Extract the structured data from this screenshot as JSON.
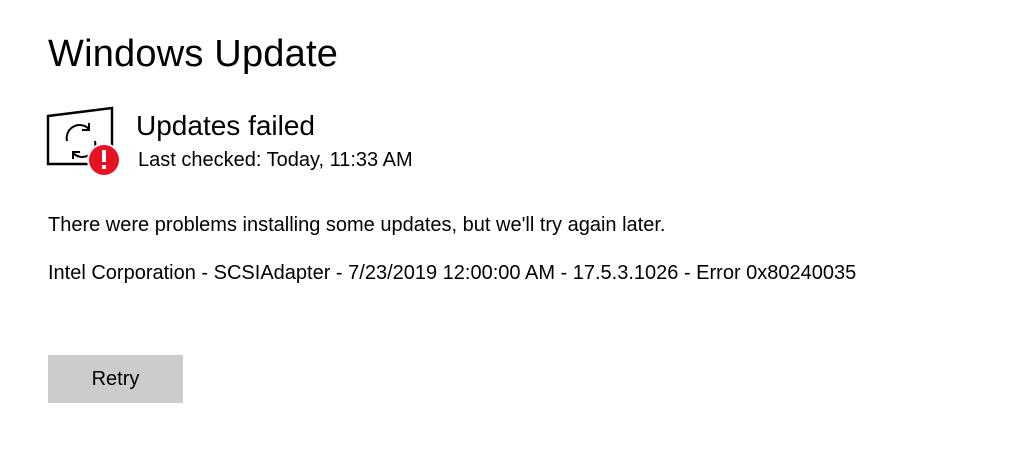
{
  "header": {
    "title": "Windows Update"
  },
  "status": {
    "title": "Updates failed",
    "last_checked": "Last checked: Today, 11:33 AM",
    "icon": "update-failed-icon",
    "error_color": "#e81123"
  },
  "message": "There were problems installing some updates, but we'll try again later.",
  "failed_update": "Intel Corporation - SCSIAdapter - 7/23/2019 12:00:00 AM - 17.5.3.1026 - Error 0x80240035",
  "actions": {
    "retry_label": "Retry"
  }
}
